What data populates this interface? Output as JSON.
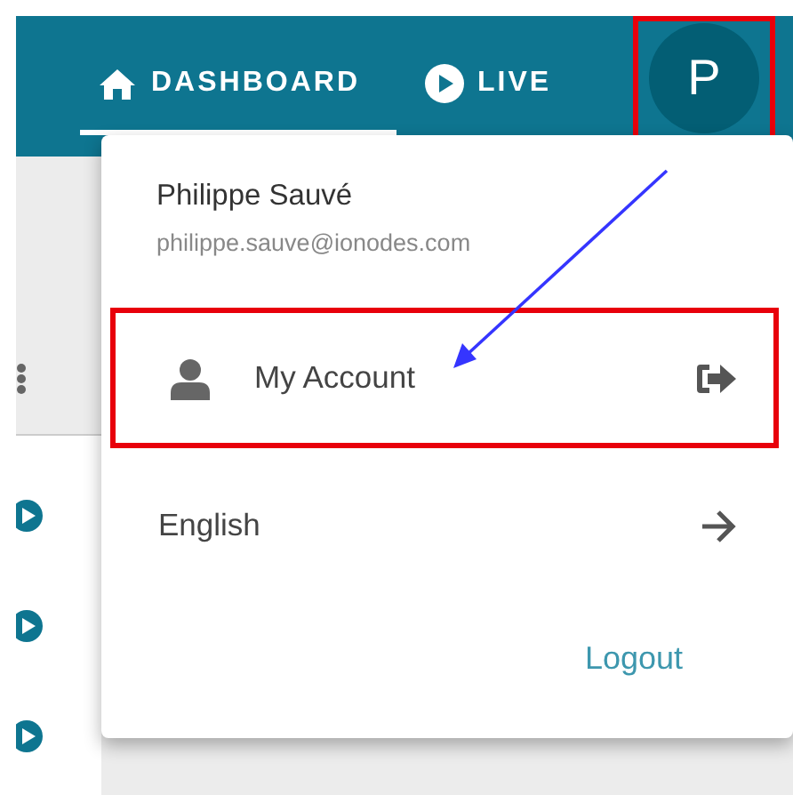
{
  "header": {
    "tabs": [
      {
        "label": "DASHBOARD",
        "kind": "home",
        "selected": true
      },
      {
        "label": "LIVE",
        "kind": "play",
        "selected": false
      }
    ],
    "avatar": {
      "letter": "P",
      "highlighted": true
    }
  },
  "sidebar": {
    "items": [
      {
        "kind": "more"
      },
      {
        "kind": "play"
      },
      {
        "kind": "play"
      },
      {
        "kind": "play"
      }
    ]
  },
  "user_menu": {
    "name": "Philippe Sauvé",
    "email": "philippe.sauve@ionodes.com",
    "items": [
      {
        "label": "My Account",
        "kind": "account",
        "highlighted": true
      },
      {
        "label": "English",
        "kind": "language",
        "highlighted": false
      }
    ],
    "logout": "Logout"
  },
  "callout_arrow": true
}
